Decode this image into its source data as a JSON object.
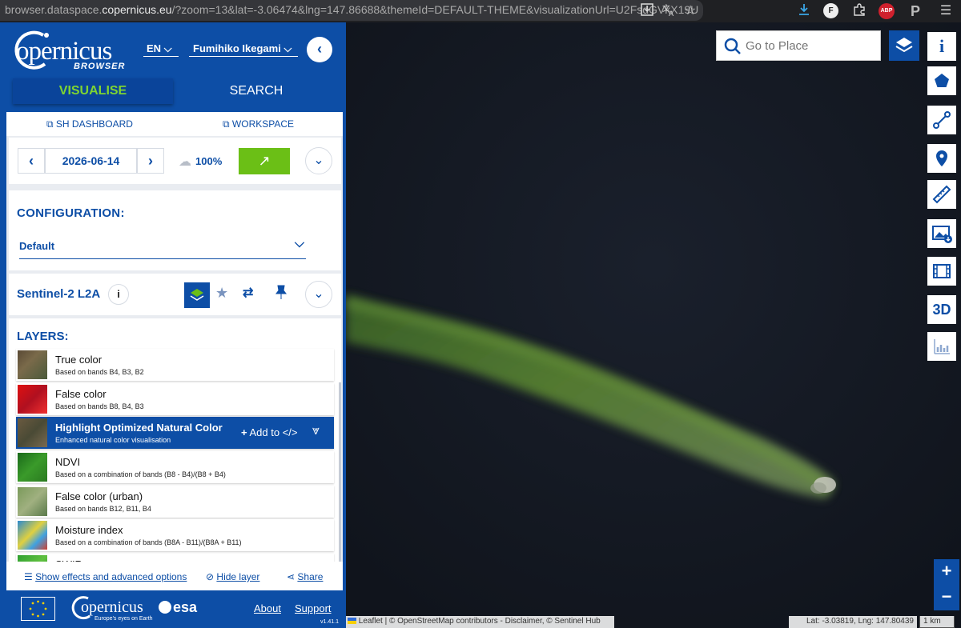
{
  "browser": {
    "url_prefix": "browser.dataspace.",
    "url_domain": "copernicus.eu",
    "url_rest": "/?zoom=13&lat=-3.06474&lng=147.86688&themeId=DEFAULT-THEME&visualizationUrl=U2FsdGVkX19U",
    "ext_f": "F",
    "ext_abp": "ABP",
    "ext_p": "P"
  },
  "header": {
    "logo_word": "opernicus",
    "logo_sub": "BROWSER",
    "language": "EN",
    "user_name": "Fumihiko Ikegami"
  },
  "tabs": [
    {
      "label": "VISUALISE"
    },
    {
      "label": "SEARCH"
    }
  ],
  "links": {
    "sh_dashboard": "SH DASHBOARD",
    "workspace": "WORKSPACE"
  },
  "date_bar": {
    "date": "2026-06-14",
    "cloud_coverage": "100%"
  },
  "configuration": {
    "title": "CONFIGURATION:",
    "selected": "Default"
  },
  "collection": {
    "name": "Sentinel-2 L2A"
  },
  "layers": {
    "title": "LAYERS:",
    "add_to_label": "Add to",
    "items": [
      {
        "title": "True color",
        "subtitle": "Based on bands B4, B3, B2"
      },
      {
        "title": "False color",
        "subtitle": "Based on bands B8, B4, B3"
      },
      {
        "title": "Highlight Optimized Natural Color",
        "subtitle": "Enhanced natural color visualisation"
      },
      {
        "title": "NDVI",
        "subtitle": "Based on a combination of bands (B8 - B4)/(B8 + B4)"
      },
      {
        "title": "False color (urban)",
        "subtitle": "Based on bands B12, B11, B4"
      },
      {
        "title": "Moisture index",
        "subtitle": "Based on a combination of bands (B8A - B11)/(B8A + B11)"
      },
      {
        "title": "SWIR",
        "subtitle": ""
      }
    ]
  },
  "footer_actions": {
    "effects": "Show effects and advanced options",
    "hide_layer": "Hide layer",
    "share": "Share"
  },
  "footer": {
    "copernicus_word": "opernicus",
    "tagline": "Europe's eyes on Earth",
    "esa": "esa",
    "about": "About",
    "support": "Support",
    "version": "v1.41.1"
  },
  "map": {
    "search_placeholder": "Go to Place",
    "three_d": "3D",
    "attribution": "Leaflet | © OpenStreetMap contributors - Disclaimer, © Sentinel Hub",
    "coordinates": "Lat: -3.03819, Lng: 147.80439",
    "scale": "1 km",
    "zoom_in": "+",
    "zoom_out": "−"
  },
  "colors": {
    "brand_blue": "#0d4ea6",
    "accent_green": "#6bbf16",
    "active_tab_text": "#7fd531"
  }
}
